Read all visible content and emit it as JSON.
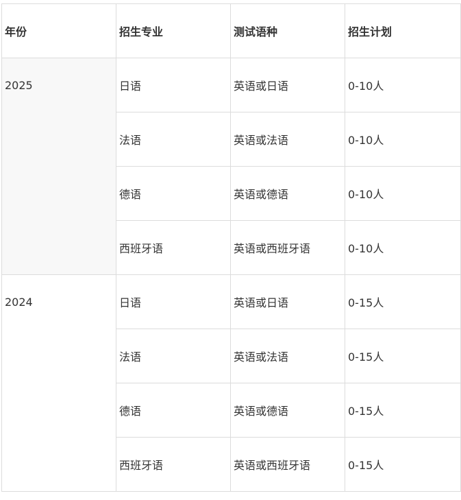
{
  "headers": {
    "year": "年份",
    "major": "招生专业",
    "language": "测试语种",
    "plan": "招生计划"
  },
  "groups": [
    {
      "year": "2025",
      "rows": [
        {
          "major": "日语",
          "language": "英语或日语",
          "plan": "0-10人"
        },
        {
          "major": "法语",
          "language": "英语或法语",
          "plan": "0-10人"
        },
        {
          "major": "德语",
          "language": "英语或德语",
          "plan": "0-10人"
        },
        {
          "major": "西班牙语",
          "language": "英语或西班牙语",
          "plan": "0-10人"
        }
      ]
    },
    {
      "year": "2024",
      "rows": [
        {
          "major": "日语",
          "language": "英语或日语",
          "plan": "0-15人"
        },
        {
          "major": "法语",
          "language": "英语或法语",
          "plan": "0-15人"
        },
        {
          "major": "德语",
          "language": "英语或德语",
          "plan": "0-15人"
        },
        {
          "major": "西班牙语",
          "language": "英语或西班牙语",
          "plan": "0-15人"
        }
      ]
    }
  ]
}
